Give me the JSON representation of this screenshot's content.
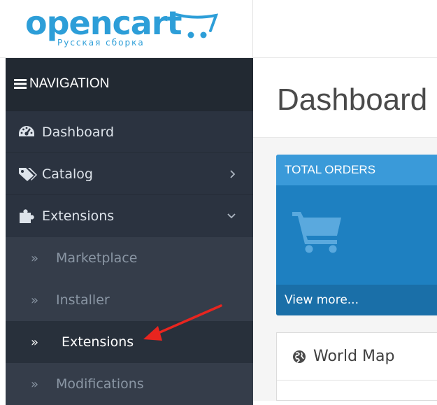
{
  "brand": {
    "name": "opencart",
    "subtitle": "Русская сборка",
    "color": "#2d9ed8"
  },
  "sidebar": {
    "header_label": "NAVIGATION",
    "header_icon": "hamburger-icon",
    "items": [
      {
        "label": "Dashboard",
        "icon": "dashboard-icon"
      },
      {
        "label": "Catalog",
        "icon": "tags-icon",
        "caret": "chevron-right-icon"
      },
      {
        "label": "Extensions",
        "icon": "puzzle-icon",
        "caret": "chevron-down-icon"
      }
    ],
    "subitems": [
      {
        "label": "Marketplace",
        "active": false
      },
      {
        "label": "Installer",
        "active": false
      },
      {
        "label": "Extensions",
        "active": true
      },
      {
        "label": "Modifications",
        "active": false
      }
    ]
  },
  "main": {
    "title": "Dashboard",
    "tile": {
      "heading": "TOTAL ORDERS",
      "icon": "shopping-cart-icon",
      "link": "View more..."
    },
    "panel": {
      "title": "World Map",
      "icon": "globe-icon"
    }
  },
  "annotation": {
    "arrow_color": "#e8251f"
  },
  "colors": {
    "sidebar_bg": "#2b3340",
    "sidebar_header_bg": "#222932",
    "tile_bg": "#1e80c1",
    "tile_head_bg": "#3a9ad9"
  }
}
